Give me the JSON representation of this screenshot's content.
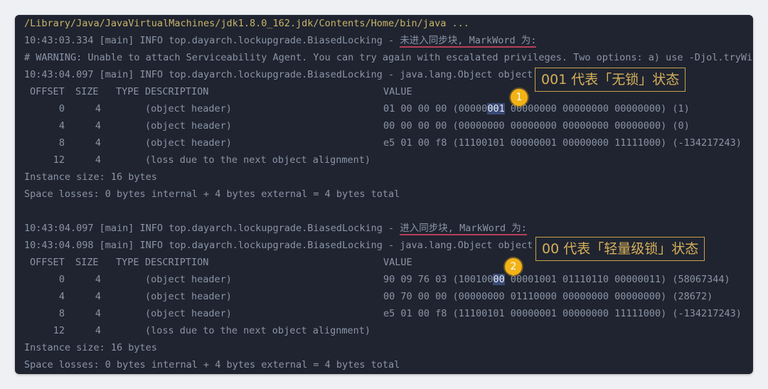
{
  "terminal": {
    "path": "/Library/Java/JavaVirtualMachines/jdk1.8.0_162.jdk/Contents/Home/bin/java ...",
    "warning": "# WARNING: Unable to attach Serviceability Agent. You can try again with escalated privileges. Two options: a) use -Djol.tryWith",
    "block1": {
      "log_prefix": "10:43:03.334 [main] INFO top.dayarch.lockupgrade.BiasedLocking - ",
      "log_marker": "未进入同步块, MarkWord 为:",
      "internals": "10:43:04.097 [main] INFO top.dayarch.lockupgrade.BiasedLocking - java.lang.Object object internals:",
      "header": {
        "offset": "OFFSET",
        "size": "SIZE",
        "type": "TYPE",
        "description": "DESCRIPTION",
        "value": "VALUE"
      },
      "rows": [
        {
          "offset": "0",
          "size": "4",
          "description": "(object header)",
          "value_pre": "01 00 00 00 (00000",
          "value_hl": "001",
          "value_post": " 00000000 00000000 00000000) (1)"
        },
        {
          "offset": "4",
          "size": "4",
          "description": "(object header)",
          "value_pre": "00 00 00 00 (00000000 00000000 00000000 00000000) (0)",
          "value_hl": "",
          "value_post": ""
        },
        {
          "offset": "8",
          "size": "4",
          "description": "(object header)",
          "value_pre": "e5 01 00 f8 (11100101 00000001 00000000 11111000) (-134217243)",
          "value_hl": "",
          "value_post": ""
        },
        {
          "offset": "12",
          "size": "4",
          "description": "(loss due to the next object alignment)",
          "value_pre": "",
          "value_hl": "",
          "value_post": ""
        }
      ],
      "instance_size": "Instance size: 16 bytes",
      "space_losses": "Space losses: 0 bytes internal + 4 bytes external = 4 bytes total"
    },
    "block2": {
      "log_prefix": "10:43:04.097 [main] INFO top.dayarch.lockupgrade.BiasedLocking - ",
      "log_marker": "进入同步块, MarkWord 为:",
      "internals": "10:43:04.098 [main] INFO top.dayarch.lockupgrade.BiasedLocking - java.lang.Object object internals:",
      "header": {
        "offset": "OFFSET",
        "size": "SIZE",
        "type": "TYPE",
        "description": "DESCRIPTION",
        "value": "VALUE"
      },
      "rows": [
        {
          "offset": "0",
          "size": "4",
          "description": "(object header)",
          "value_pre": "90 09 76 03 (100100",
          "value_hl": "00",
          "value_post": " 00001001 01110110 00000011) (58067344)"
        },
        {
          "offset": "4",
          "size": "4",
          "description": "(object header)",
          "value_pre": "00 70 00 00 (00000000 01110000 00000000 00000000) (28672)",
          "value_hl": "",
          "value_post": ""
        },
        {
          "offset": "8",
          "size": "4",
          "description": "(object header)",
          "value_pre": "e5 01 00 f8 (11100101 00000001 00000000 11111000) (-134217243)",
          "value_hl": "",
          "value_post": ""
        },
        {
          "offset": "12",
          "size": "4",
          "description": "(loss due to the next object alignment)",
          "value_pre": "",
          "value_hl": "",
          "value_post": ""
        }
      ],
      "instance_size": "Instance size: 16 bytes",
      "space_losses": "Space losses: 0 bytes internal + 4 bytes external = 4 bytes total"
    }
  },
  "annotations": {
    "callout1": "001 代表「无锁」状态",
    "badge1": "1",
    "callout2": "00 代表「轻量级锁」状态",
    "badge2": "2"
  },
  "colors": {
    "terminal_bg": "#1f2430",
    "text": "#8b94a6",
    "path_text": "#c9b46a",
    "underline": "#b5405a",
    "callout_border": "#c9a24a",
    "badge": "#f3b316"
  }
}
